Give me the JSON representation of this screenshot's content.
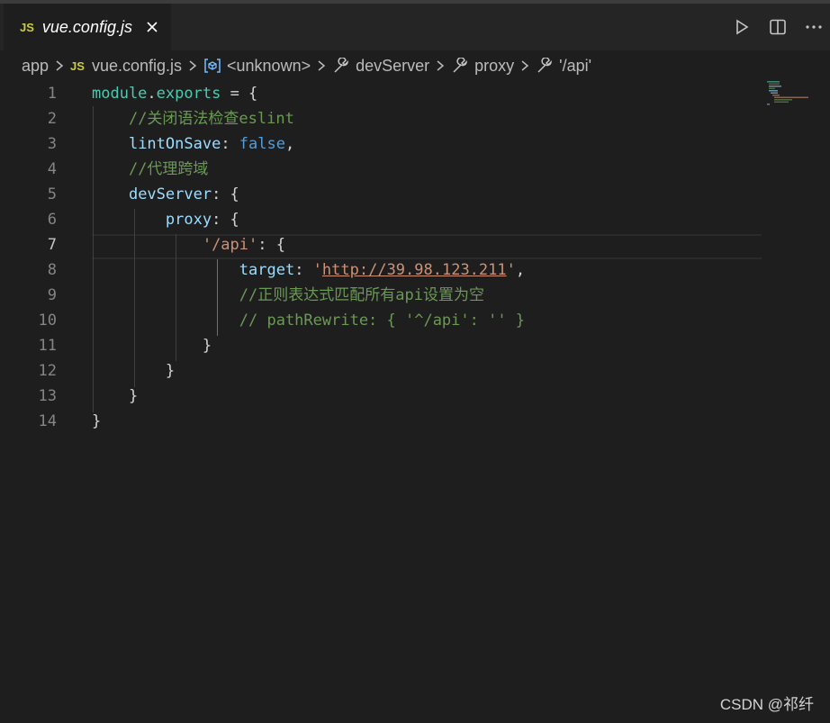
{
  "tab": {
    "badge": "JS",
    "title": "vue.config.js"
  },
  "breadcrumb": {
    "items": [
      "app",
      "vue.config.js",
      "<unknown>",
      "devServer",
      "proxy",
      "'/api'"
    ],
    "file_badge": "JS"
  },
  "editor": {
    "lines": [
      {
        "n": "1",
        "tokens": [
          [
            "m",
            "module"
          ],
          [
            "p",
            "."
          ],
          [
            "m",
            "exports"
          ],
          [
            "p",
            " = {"
          ]
        ]
      },
      {
        "n": "2",
        "tokens": [
          [
            "p",
            "    "
          ],
          [
            "c",
            "//关闭语法检查eslint"
          ]
        ]
      },
      {
        "n": "3",
        "tokens": [
          [
            "p",
            "    "
          ],
          [
            "k",
            "lintOnSave"
          ],
          [
            "p",
            ": "
          ],
          [
            "b",
            "false"
          ],
          [
            "p",
            ","
          ]
        ]
      },
      {
        "n": "4",
        "tokens": [
          [
            "p",
            "    "
          ],
          [
            "c",
            "//代理跨域"
          ]
        ]
      },
      {
        "n": "5",
        "tokens": [
          [
            "p",
            "    "
          ],
          [
            "k",
            "devServer"
          ],
          [
            "p",
            ": {"
          ]
        ]
      },
      {
        "n": "6",
        "tokens": [
          [
            "p",
            "        "
          ],
          [
            "k",
            "proxy"
          ],
          [
            "p",
            ": {"
          ]
        ]
      },
      {
        "n": "7",
        "tokens": [
          [
            "p",
            "            "
          ],
          [
            "s",
            "'/api'"
          ],
          [
            "p",
            ": {"
          ]
        ]
      },
      {
        "n": "8",
        "tokens": [
          [
            "p",
            "                "
          ],
          [
            "k",
            "target"
          ],
          [
            "p",
            ": "
          ],
          [
            "s",
            "'"
          ],
          [
            "s url",
            "http://39.98.123.211"
          ],
          [
            "s",
            "'"
          ],
          [
            "p",
            ","
          ]
        ]
      },
      {
        "n": "9",
        "tokens": [
          [
            "p",
            "                "
          ],
          [
            "c",
            "//正则表达式匹配所有api设置为空"
          ]
        ]
      },
      {
        "n": "10",
        "tokens": [
          [
            "p",
            "                "
          ],
          [
            "c",
            "// pathRewrite: { '^/api': '' }"
          ]
        ]
      },
      {
        "n": "11",
        "tokens": [
          [
            "p",
            "            }"
          ]
        ]
      },
      {
        "n": "12",
        "tokens": [
          [
            "p",
            "        }"
          ]
        ]
      },
      {
        "n": "13",
        "tokens": [
          [
            "p",
            "    }"
          ]
        ]
      },
      {
        "n": "14",
        "tokens": [
          [
            "p",
            "}"
          ]
        ]
      }
    ],
    "active_line": 7
  },
  "watermark": "CSDN @祁纤",
  "colors": {
    "keyword": "#9cdcfe",
    "module": "#4ec9b0",
    "comment": "#6a9955",
    "boolean": "#569cd6",
    "string": "#ce9178",
    "punct": "#d4d4d4",
    "js_badge": "#cbcb41",
    "background": "#1e1e1e"
  },
  "icons": [
    "close-icon",
    "run-icon",
    "split-editor-icon",
    "chevron-right-icon",
    "symbol-variable-icon",
    "wrench-icon"
  ]
}
